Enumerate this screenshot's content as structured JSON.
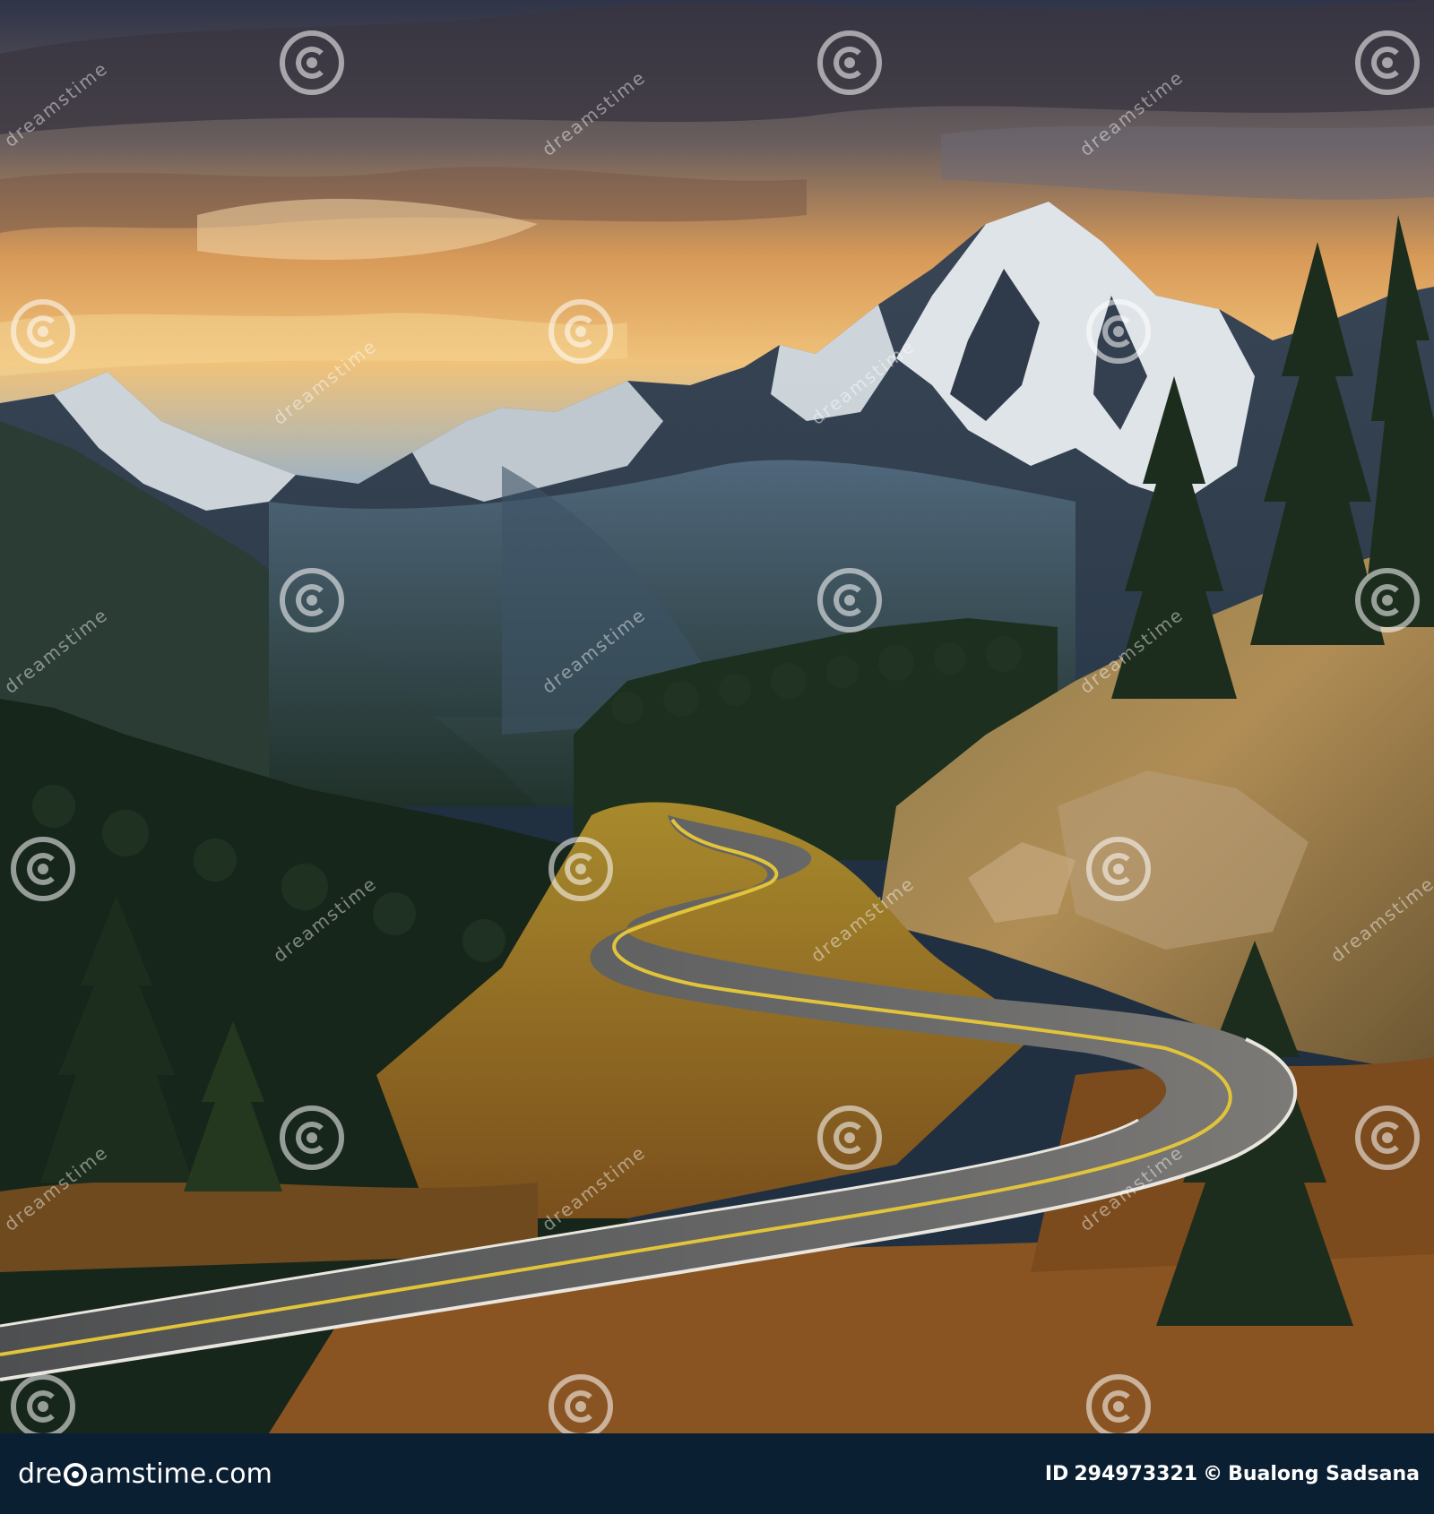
{
  "footer": {
    "brand_prefix": "dre",
    "brand_suffix": "amstime.com",
    "id_label": "ID",
    "id_value": "294973321",
    "copyright_symbol": "©",
    "author": "Bualong Sadsana"
  },
  "watermark": {
    "text": "dreamstime",
    "icon": "dreamstime-spiral-icon"
  },
  "colors": {
    "footer_bg": "#0b1f33",
    "sky_top": "#2f3448",
    "sunset": "#f5b860",
    "road": "#5d5e5f",
    "center_line": "#e2c43a"
  }
}
